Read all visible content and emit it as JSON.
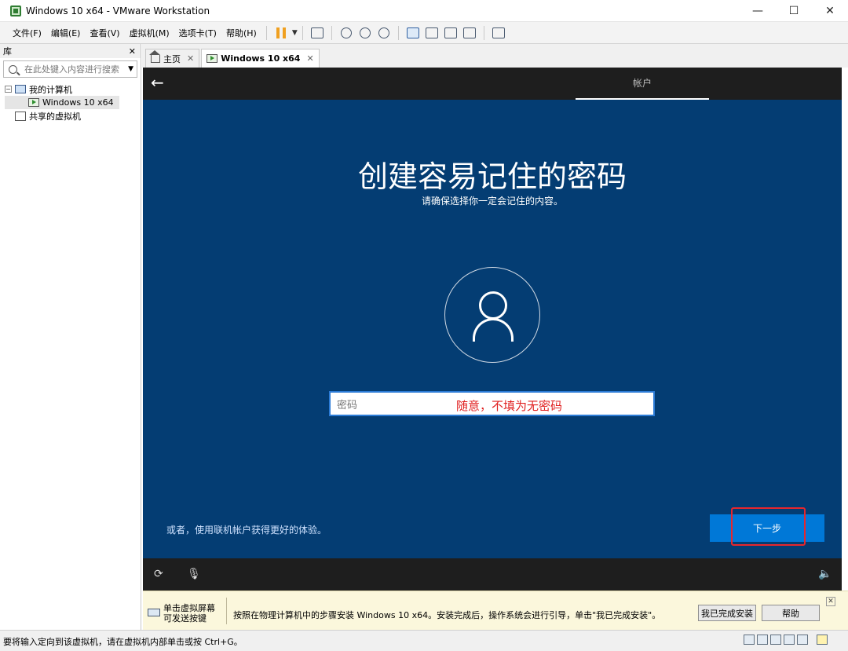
{
  "window": {
    "title": "Windows 10 x64 - VMware Workstation",
    "controls": [
      "—",
      "☐",
      "✕"
    ]
  },
  "menu": {
    "items": [
      "文件(F)",
      "编辑(E)",
      "查看(V)",
      "虚拟机(M)",
      "选项卡(T)",
      "帮助(H)"
    ]
  },
  "library": {
    "title": "库",
    "close": "✕",
    "search_placeholder": "在此处键入内容进行搜索",
    "tree": {
      "my_computer": "我的计算机",
      "vm": "Windows 10 x64",
      "shared": "共享的虚拟机"
    }
  },
  "tabs": [
    {
      "label": "主页",
      "close": "✕"
    },
    {
      "label": "Windows 10 x64",
      "close": "✕"
    }
  ],
  "vm_screen": {
    "top_tab": "帐户",
    "heading": "创建容易记住的密码",
    "subheading": "请确保选择你一定会记住的内容。",
    "password_placeholder": "密码",
    "annotation": "随意，不填为无密码",
    "alt_link": "或者，使用联机帐户获得更好的体验。",
    "next_button": "下一步"
  },
  "infobar": {
    "hint": "单击虚拟屏幕\n可发送按键",
    "message": "按照在物理计算机中的步骤安装 Windows 10 x64。安装完成后，操作系统会进行引导，单击\"我已完成安装\"。",
    "done_button": "我已完成安装",
    "help_button": "帮助"
  },
  "statusbar": {
    "text": "要将输入定向到该虚拟机，请在虚拟机内部单击或按 Ctrl+G。"
  },
  "colors": {
    "vm_background": "#043d73",
    "button_blue": "#0078d7",
    "annotation_red": "#e02020"
  }
}
